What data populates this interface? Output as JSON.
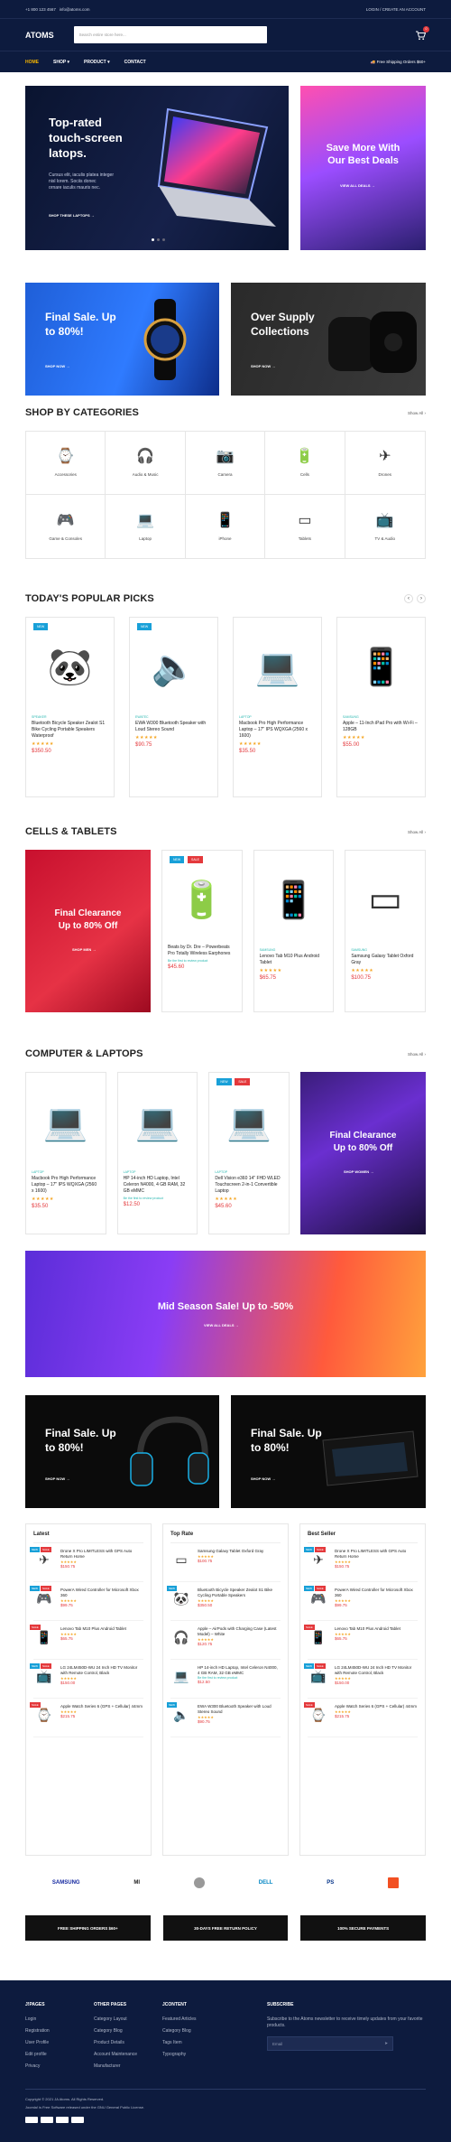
{
  "topbar": {
    "phone": "+1 800 123 4567",
    "email": "info@atoms.com",
    "account": "LOGIN / CREATE AN ACCOUNT"
  },
  "header": {
    "logo": "ATOMS",
    "search_placeholder": "Search entire store here...",
    "cart_count": "0"
  },
  "nav": {
    "items": [
      "HOME",
      "SHOP",
      "PRODUCT",
      "CONTACT"
    ],
    "shipping": "Free Shipping Orders $60+"
  },
  "hero": {
    "main": {
      "title_1": "Top-rated",
      "title_2": "touch-screen",
      "title_3": "latops.",
      "desc_1": "Cursus elit, iaculis platea integer",
      "desc_2": "nisl lorem. Sociis donec",
      "desc_3": "ornare iaculis mauris nec.",
      "cta": "SHOP THESE LAPTOPS"
    },
    "side": {
      "title_1": "Save More With",
      "title_2": "Our Best Deals",
      "cta": "VIEW ALL DEALS"
    }
  },
  "promo_row_1": [
    {
      "title_1": "Final Sale. Up",
      "title_2": "to 80%!",
      "cta": "SHOP NOW"
    },
    {
      "title_1": "Over Supply",
      "title_2": "Collections",
      "cta": "SHOP NOW"
    }
  ],
  "categories": {
    "title": "SHOP BY CATEGORIES",
    "show_all": "Show All",
    "items": [
      {
        "label": "Accessories",
        "icon": "⌚"
      },
      {
        "label": "Audio & Music",
        "icon": "🎧"
      },
      {
        "label": "Camera",
        "icon": "📷"
      },
      {
        "label": "Cells",
        "icon": "🔋"
      },
      {
        "label": "Drones",
        "icon": "✈"
      },
      {
        "label": "Game & Consoles",
        "icon": "🎮"
      },
      {
        "label": "Laptop",
        "icon": "💻"
      },
      {
        "label": "iPhone",
        "icon": "📱"
      },
      {
        "label": "Tablets",
        "icon": "▭"
      },
      {
        "label": "TV & Audio",
        "icon": "📺"
      }
    ]
  },
  "popular": {
    "title": "TODAY'S POPULAR PICKS",
    "products": [
      {
        "badge": "NEW",
        "category": "SPEAKER",
        "name": "Bluetooth Bicycle Speaker Zealot S1 Bike Cycling Portable Speakers Waterproof",
        "stars": "★★★★★",
        "price": "$350.50",
        "icon": "🐼"
      },
      {
        "badge": "NEW",
        "category": "EWATEC",
        "name": "EWA W300 Bluetooth Speaker with Loud Stereo Sound",
        "stars": "★★★★★",
        "price": "$90.75",
        "icon": "🔈"
      },
      {
        "badge": "",
        "category": "LAPTOP",
        "name": "Macbook Pro High Performance Laptop – 17\" IPS WQXGA (2560 x 1600)",
        "stars": "★★★★★",
        "price": "$35.50",
        "icon": "💻"
      },
      {
        "badge": "",
        "category": "SAMSUNG",
        "name": "Apple – 11-Inch iPad Pro with Wi-Fi – 128GB",
        "stars": "★★★★★",
        "price": "$55.00",
        "icon": "📱"
      }
    ]
  },
  "cells": {
    "title": "CELLS & TABLETS",
    "show_all": "Show All",
    "banner": {
      "title_1": "Final Clearance",
      "title_2": "Up to 80% Off",
      "cta": "SHOP MEN"
    },
    "products": [
      {
        "badges": [
          "NEW",
          "SALE"
        ],
        "category": "",
        "name": "Beats by Dr. Dre – Powerbeats Pro Totally Wireless Earphones",
        "note": "",
        "stars": "",
        "price": "$45.60",
        "icon": "🔋"
      },
      {
        "badges": [],
        "category": "SAMSUNG",
        "name": "Lenovo Tab M10 Plus Android Tablet",
        "note": "",
        "stars": "★★★★★",
        "price": "$65.75",
        "icon": "📱"
      },
      {
        "badges": [],
        "category": "SAMSUNG",
        "name": "Samsung Galaxy Tablet Oxford Gray",
        "note": "",
        "stars": "★★★★★",
        "price": "$100.75",
        "icon": "▭"
      }
    ],
    "first_note": "Be the first to review product"
  },
  "computers": {
    "title": "COMPUTER & LAPTOPS",
    "show_all": "Show All",
    "banner": {
      "title_1": "Final Clearance",
      "title_2": "Up to 80% Off",
      "cta": "SHOP WOMEN"
    },
    "products": [
      {
        "badges": [],
        "category": "LAPTOP",
        "name": "Macbook Pro High Performance Laptop – 17\" IPS WQXGA (2560 x 1600)",
        "note": "",
        "stars": "★★★★★",
        "price": "$35.50",
        "icon": "💻"
      },
      {
        "badges": [],
        "category": "LAPTOP",
        "name": "HP 14-inch HD Laptop, Intel Celeron N4000, 4 GB RAM, 32 GB eMMC",
        "note": "Be the first to review product",
        "stars": "",
        "price": "$12.50",
        "icon": "💻"
      },
      {
        "badges": [
          "NEW",
          "SALE"
        ],
        "category": "LAPTOP",
        "name": "Dell Vision e360 14\" FHD WLED Touchscreen 2-in-1 Convertible Laptop",
        "note": "",
        "stars": "★★★★★",
        "price": "$45.60",
        "icon": "💻"
      }
    ]
  },
  "mid_season": {
    "title": "Mid Season Sale! Up to -50%",
    "cta": "VIEW ALL DEALS"
  },
  "promo_row_2": [
    {
      "title_1": "Final Sale. Up",
      "title_2": "to 80%!",
      "cta": "SHOP NOW"
    },
    {
      "title_1": "Final Sale. Up",
      "title_2": "to 80%!",
      "cta": "SHOP NOW"
    }
  ],
  "lists": [
    {
      "title": "Latest",
      "items": [
        {
          "badges": [
            "NEW",
            "SALE"
          ],
          "name": "Drone X Pro LIMITLESS with GPS Auto Return Home",
          "note": "",
          "stars": "★★★★★",
          "price": "$150.75",
          "icon": "✈"
        },
        {
          "badges": [
            "NEW",
            "SALE"
          ],
          "name": "PowerA Wired Controller for Microsoft Xbox 360",
          "note": "",
          "stars": "★★★★★",
          "price": "$99.75",
          "icon": "🎮"
        },
        {
          "badges": [
            "SALE"
          ],
          "name": "Lenovo Tab M10 Plus Android Tablet",
          "note": "",
          "stars": "★★★★★",
          "price": "$65.75",
          "icon": "📱"
        },
        {
          "badges": [
            "NEW",
            "SALE"
          ],
          "name": "LG 24LM450D-WU 24 Inch HD TV Monitor with Remote Control, Black",
          "note": "",
          "stars": "★★★★★",
          "price": "$150.00",
          "icon": "📺"
        },
        {
          "badges": [
            "SALE"
          ],
          "name": "Apple Watch Series 6 (GPS + Cellular) 44mm",
          "note": "",
          "stars": "★★★★★",
          "price": "$215.75",
          "icon": "⌚"
        }
      ]
    },
    {
      "title": "Top Rate",
      "items": [
        {
          "badges": [],
          "name": "Samsung Galaxy Tablet Oxford Gray",
          "note": "",
          "stars": "★★★★★",
          "price": "$100.75",
          "icon": "▭"
        },
        {
          "badges": [
            "NEW"
          ],
          "name": "Bluetooth Bicycle Speaker Zealot S1 Bike Cycling Portable Speakers",
          "note": "",
          "stars": "★★★★★",
          "price": "$350.50",
          "icon": "🐼"
        },
        {
          "badges": [],
          "name": "Apple – AirPods with Charging Case (Latest Model) – White",
          "note": "",
          "stars": "★★★★★",
          "price": "$120.75",
          "icon": "🎧"
        },
        {
          "badges": [],
          "name": "HP 14-inch HD Laptop, Intel Celeron N4000, 4 GB RAM, 32 GB eMMC",
          "note": "Be the first to review product",
          "stars": "",
          "price": "$12.50",
          "icon": "💻"
        },
        {
          "badges": [
            "NEW"
          ],
          "name": "EWA W300 Bluetooth Speaker with Loud Stereo Sound",
          "note": "",
          "stars": "★★★★★",
          "price": "$90.75",
          "icon": "🔈"
        }
      ]
    },
    {
      "title": "Best Seller",
      "items": [
        {
          "badges": [
            "NEW",
            "SALE"
          ],
          "name": "Drone X Pro LIMITLESS with GPS Auto Return Home",
          "note": "",
          "stars": "★★★★★",
          "price": "$150.75",
          "icon": "✈"
        },
        {
          "badges": [
            "NEW",
            "SALE"
          ],
          "name": "PowerA Wired Controller for Microsoft Xbox 360",
          "note": "",
          "stars": "★★★★★",
          "price": "$99.75",
          "icon": "🎮"
        },
        {
          "badges": [
            "SALE"
          ],
          "name": "Lenovo Tab M10 Plus Android Tablet",
          "note": "",
          "stars": "★★★★★",
          "price": "$65.75",
          "icon": "📱"
        },
        {
          "badges": [
            "NEW",
            "SALE"
          ],
          "name": "LG 24LM450D-WU 24 Inch HD TV Monitor with Remote Control, Black",
          "note": "",
          "stars": "★★★★★",
          "price": "$150.00",
          "icon": "📺"
        },
        {
          "badges": [
            "SALE"
          ],
          "name": "Apple Watch Series 6 (GPS + Cellular) 44mm",
          "note": "",
          "stars": "★★★★★",
          "price": "$215.75",
          "icon": "⌚"
        }
      ]
    }
  ],
  "brands": [
    {
      "label": "SAMSUNG",
      "color": "#1428a0"
    },
    {
      "label": "MI",
      "color": "#222222"
    },
    {
      "label": "",
      "color": "#999999"
    },
    {
      "label": "DELL",
      "color": "#0085c3"
    },
    {
      "label": "PS",
      "color": "#003087"
    },
    {
      "label": "",
      "color": "#f25022"
    }
  ],
  "services": [
    "FREE SHIPPING ORDERS $60+",
    "30-DAYS FREE RETURN POLICY",
    "100% SECURE PAYMENTS"
  ],
  "footer": {
    "cols": [
      {
        "title": "J!PAGES",
        "links": [
          "Login",
          "Registration",
          "User Profile",
          "Edit profile",
          "Privacy"
        ]
      },
      {
        "title": "OTHER PAGES",
        "links": [
          "Category Layout",
          "Category Blog",
          "Product Details",
          "Account Maintenance",
          "Manufacturer"
        ]
      },
      {
        "title": "JCONTENT",
        "links": [
          "Featured Articles",
          "Category Blog",
          "Tags Item",
          "Typography"
        ]
      }
    ],
    "subscribe": {
      "title": "SUBSCRIBE",
      "text": "Subscribe to the Atoms newsletter to receive timely updates from your favorite products.",
      "placeholder": "Email"
    },
    "copyright": "Copyright © 2021 JA Atoms. All Rights Reserved.",
    "license": "Joomla! is Free Software released under the GNU General Public License."
  }
}
